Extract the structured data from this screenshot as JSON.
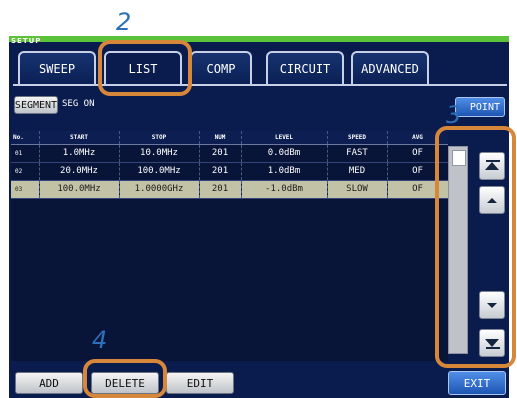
{
  "header": {
    "section_label": "SETUP"
  },
  "tabs": [
    {
      "label": "SWEEP"
    },
    {
      "label": "LIST"
    },
    {
      "label": "COMP"
    },
    {
      "label": "CIRCUIT"
    },
    {
      "label": "ADVANCED"
    }
  ],
  "toolbar": {
    "segment_label": "SEGMENT",
    "seg_status": "SEG ON",
    "point_label": "POINT"
  },
  "table": {
    "columns": [
      "No.",
      "START",
      "STOP",
      "NUM",
      "LEVEL",
      "SPEED",
      "AVG"
    ],
    "rows": [
      {
        "no": "01",
        "start": "1.0MHz",
        "stop": "10.0MHz",
        "num": "201",
        "level": "0.0dBm",
        "speed": "FAST",
        "avg": "OF"
      },
      {
        "no": "02",
        "start": "20.0MHz",
        "stop": "100.0MHz",
        "num": "201",
        "level": "1.0dBm",
        "speed": "MED",
        "avg": "OF"
      },
      {
        "no": "03",
        "start": "100.0MHz",
        "stop": "1.0000GHz",
        "num": "201",
        "level": "-1.0dBm",
        "speed": "SLOW",
        "avg": "OF"
      }
    ],
    "selected_row": 2
  },
  "footer": {
    "add_label": "ADD",
    "delete_label": "DELETE",
    "edit_label": "EDIT",
    "exit_label": "EXIT"
  },
  "callouts": [
    "2",
    "3",
    "4"
  ],
  "colors": {
    "accent_orange": "#d6873a",
    "callout_blue": "#2d6fb8",
    "screen_bg": "#0a1c4e",
    "header_green": "#5cc23a",
    "selected_row": "#c2c2a6"
  },
  "icons": {
    "scroll_top": "scroll-top-icon",
    "scroll_up": "scroll-up-icon",
    "scroll_down": "scroll-down-icon",
    "scroll_bottom": "scroll-bottom-icon"
  }
}
